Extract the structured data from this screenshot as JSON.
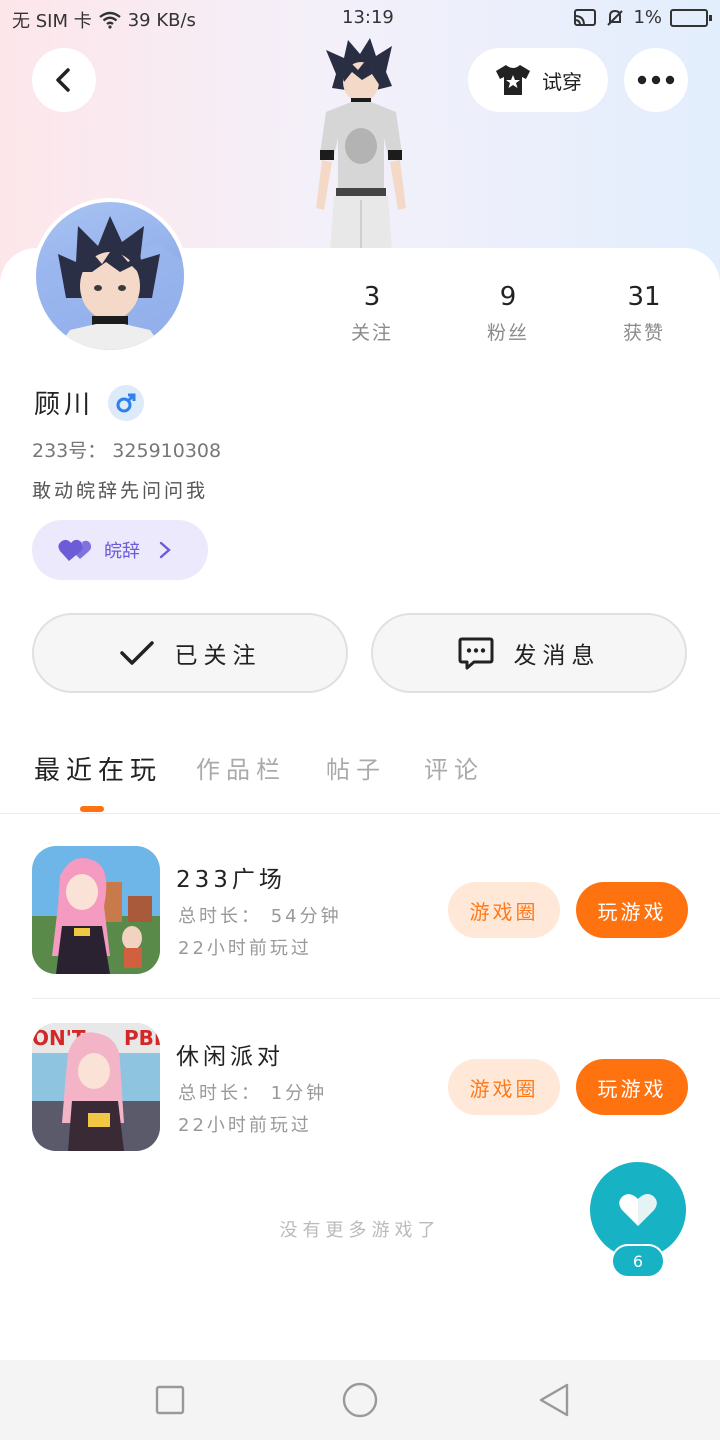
{
  "status_bar": {
    "left": "无 SIM 卡",
    "speed": "39 KB/s",
    "time": "13:19",
    "battery": "1%"
  },
  "header": {
    "try_on_label": "试穿",
    "icons": {
      "back": "back-arrow-icon",
      "more": "more-dots-icon",
      "shirt": "shirt-icon"
    }
  },
  "profile": {
    "nickname": "顾川",
    "gender_icon": "male-icon",
    "uid": "233号： 325910308",
    "bio": "敢动皖辞先问问我",
    "tag": "皖辞",
    "stats": [
      {
        "value": "3",
        "label": "关注"
      },
      {
        "value": "9",
        "label": "粉丝"
      },
      {
        "value": "31",
        "label": "获赞"
      }
    ]
  },
  "actions": {
    "follow_label": "已关注",
    "message_label": "发消息"
  },
  "tabs": [
    "最近在玩",
    "作品栏",
    "帖子",
    "评论"
  ],
  "games": [
    {
      "name": "233广场",
      "duration": "总时长： 54分钟",
      "last_played": "22小时前玩过",
      "circle_label": "游戏圈",
      "play_label": "玩游戏"
    },
    {
      "name": "休闲派对",
      "duration": "总时长： 1分钟",
      "last_played": "22小时前玩过",
      "circle_label": "游戏圈",
      "play_label": "玩游戏"
    }
  ],
  "no_more": "没有更多游戏了",
  "like_fab": {
    "count": "6",
    "icon": "heart-icon"
  },
  "colors": {
    "accent": "#ff7210",
    "teal": "#17b3c4",
    "tag_purple": "#6c5cd8"
  }
}
